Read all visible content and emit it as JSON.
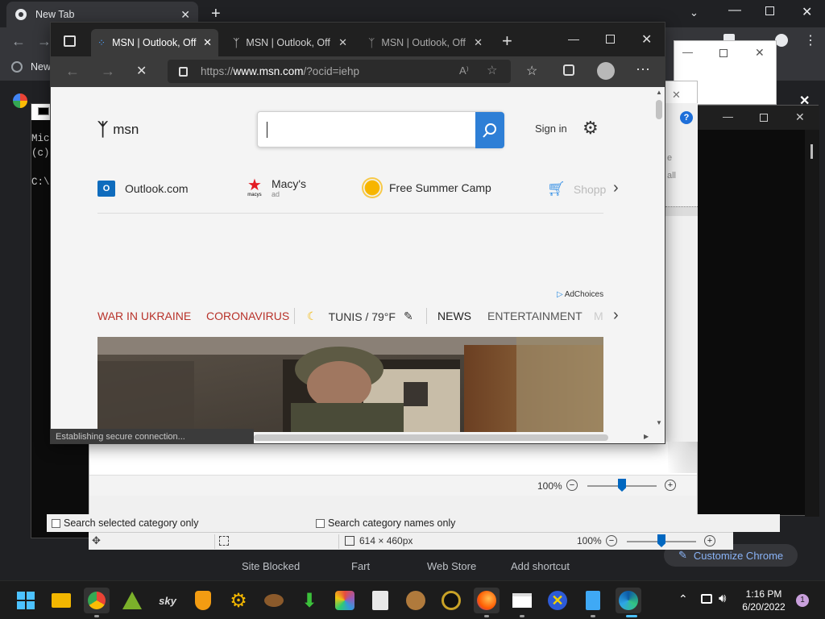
{
  "chrome": {
    "tab_title": "New Tab",
    "bookmark_first": "New",
    "shortcuts": [
      "Site Blocked",
      "Fart",
      "Web Store",
      "Add shortcut"
    ],
    "customize_label": "Customize Chrome"
  },
  "console": {
    "lines": "Mic\n(c)\n\nC:\\"
  },
  "paint": {
    "zoom": "100%",
    "zoom2": "100%",
    "dimensions": "614 × 460px",
    "check1": "Search selected category only",
    "check2": "Search category names only",
    "side_text1": "e",
    "side_text2": "all"
  },
  "edge": {
    "tabs": [
      {
        "title": "MSN | Outlook, Off"
      },
      {
        "title": "MSN | Outlook, Off"
      },
      {
        "title": "MSN | Outlook, Off"
      }
    ],
    "url_prefix": "https://",
    "url_host": "www.msn.com",
    "url_path": "/?ocid=iehp",
    "status": "Establishing secure connection..."
  },
  "msn": {
    "logo_text": "msn",
    "sign_in": "Sign in",
    "quick_links": [
      {
        "label": "Outlook.com"
      },
      {
        "label": "Macy's",
        "sub": "ad",
        "logo": "macys"
      },
      {
        "label": "Free Summer Camp"
      },
      {
        "label": "Shopp"
      }
    ],
    "adchoices": "AdChoices",
    "nav": {
      "war": "WAR IN UKRAINE",
      "corona": "CORONAVIRUS",
      "weather": "TUNIS / 79°F",
      "news": "NEWS",
      "entertainment": "ENTERTAINMENT",
      "more": "M"
    }
  },
  "taskbar": {
    "time": "1:16 PM",
    "date": "6/20/2022",
    "notifications": "1",
    "sky_label": "sky"
  },
  "colors": {
    "msn_red": "#b8322a",
    "edge_accent": "#2e7fd6",
    "chrome_dark": "#202124",
    "taskbar": "#1c1c1c"
  }
}
